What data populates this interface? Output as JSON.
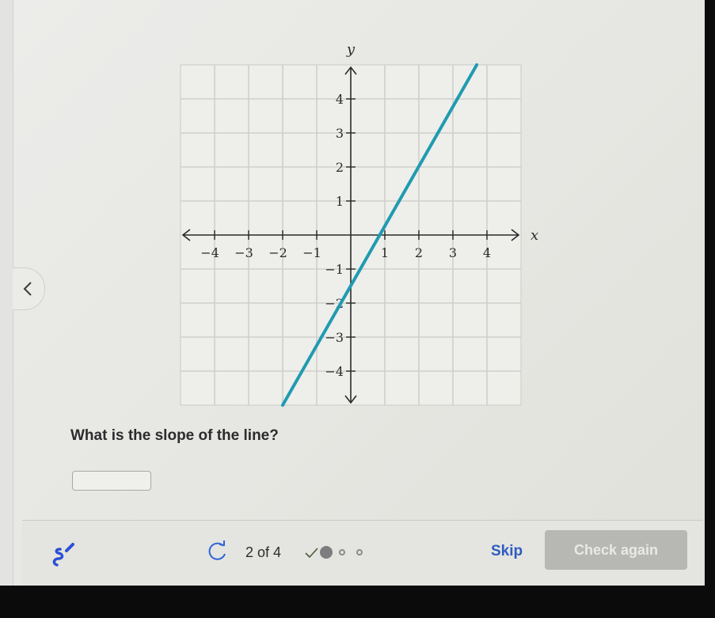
{
  "question": {
    "text": "What is the slope of the line?",
    "answer_value": "",
    "answer_placeholder": ""
  },
  "footer": {
    "progress_text": "2 of 4",
    "progress": {
      "current": 2,
      "total": 4,
      "completed": 1
    },
    "skip_label": "Skip",
    "check_label": "Check again",
    "icons": {
      "scratchpad": "scratchpad-pencil-icon",
      "redo": "redo-arrow-icon",
      "prev": "chevron-left-icon"
    }
  },
  "colors": {
    "line": "#1f9bb0",
    "skip": "#2f5cc1",
    "scratchpad": "#2b4fd6",
    "redo": "#2f64d8",
    "check_button_bg": "#b7b8b4"
  },
  "chart_data": {
    "type": "line",
    "title": "",
    "xlabel": "x",
    "ylabel": "y",
    "xlim": [
      -5,
      5
    ],
    "ylim": [
      -5,
      5
    ],
    "grid": true,
    "x_ticks": [
      -4,
      -3,
      -2,
      -1,
      1,
      2,
      3,
      4
    ],
    "y_ticks": [
      -4,
      -3,
      -2,
      -1,
      1,
      2,
      3,
      4
    ],
    "x_tick_labels": [
      "−4",
      "−3",
      "−2",
      "−1",
      "1",
      "2",
      "3",
      "4"
    ],
    "y_tick_labels": [
      "−4",
      "−3",
      "−2",
      "−1",
      "1",
      "2",
      "3",
      "4"
    ],
    "series": [
      {
        "name": "line",
        "points": [
          [
            -2,
            -5
          ],
          [
            3.7,
            5
          ]
        ]
      }
    ]
  }
}
